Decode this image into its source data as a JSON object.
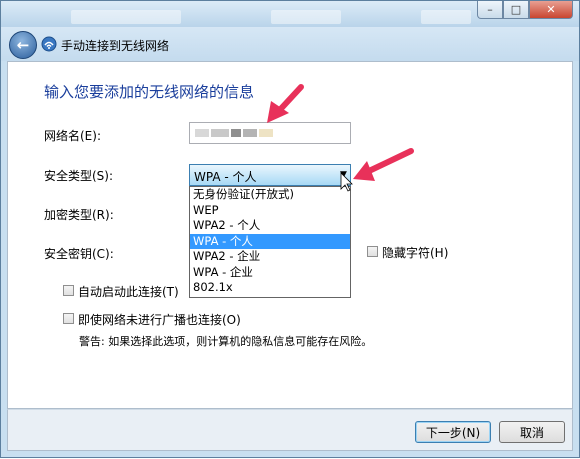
{
  "window": {
    "nav_title": "手动连接到无线网络",
    "caption": {
      "minimize": "–",
      "maximize": "□",
      "close": "✕"
    }
  },
  "form": {
    "heading": "输入您要添加的无线网络的信息",
    "network_name_label": "网络名(E):",
    "network_name_value": "",
    "security_type_label": "安全类型(S):",
    "security_type_selected": "WPA - 个人",
    "security_options": [
      "无身份验证(开放式)",
      "WEP",
      "WPA2 - 个人",
      "WPA - 个人",
      "WPA2 - 企业",
      "WPA - 企业",
      "802.1x"
    ],
    "security_selected_index": 3,
    "encryption_type_label": "加密类型(R):",
    "security_key_label": "安全密钥(C):",
    "hide_chars_label": "隐藏字符(H)",
    "auto_start_label": "自动启动此连接(T)",
    "connect_not_broadcast_label": "即使网络未进行广播也连接(O)",
    "warning_text": "警告: 如果选择此选项，则计算机的隐私信息可能存在风险。"
  },
  "footer": {
    "next_label": "下一步(N)",
    "cancel_label": "取消"
  },
  "colors": {
    "heading": "#1a3e9c",
    "selection": "#3399ff",
    "annotation_arrow": "#e8315a"
  }
}
